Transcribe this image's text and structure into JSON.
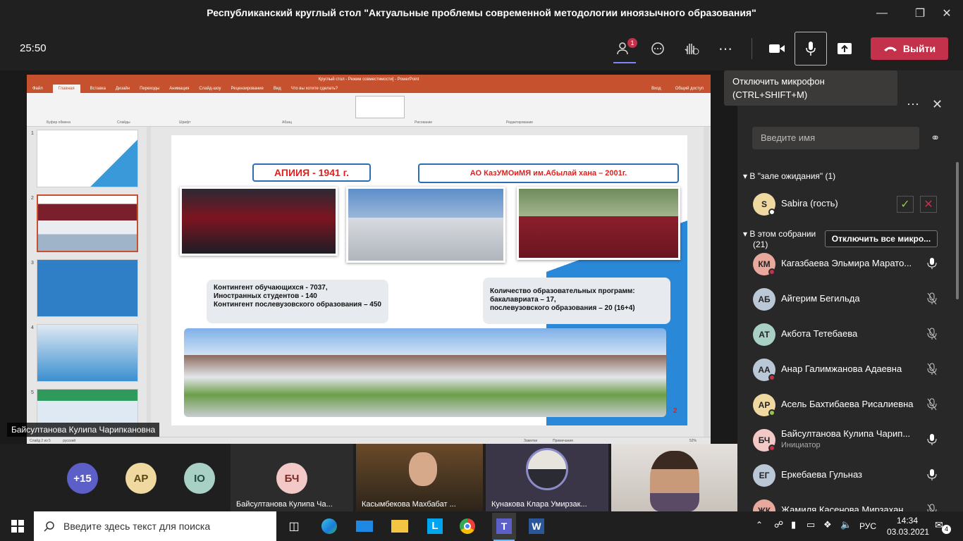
{
  "window": {
    "title": "Республиканский круглый стол \"Актуальные проблемы современной методологии иноязычного образования\""
  },
  "toolbar": {
    "time": "25:50",
    "participants_badge": "1",
    "leave_label": "Выйти"
  },
  "tooltip": {
    "line1": "Отключить микрофон",
    "line2": "(CTRL+SHIFT+M)"
  },
  "ppt": {
    "title": "Круглый стол - Режим совместимости] - PowerPoint",
    "tabs": [
      "Файл",
      "Главная",
      "Вставка",
      "Дизайн",
      "Переходы",
      "Анимация",
      "Слайд-шоу",
      "Рецензирование",
      "Вид",
      "Что вы хотите сделать?"
    ],
    "share": "Общий доступ",
    "login": "Вход",
    "ribbon_groups": [
      "Буфер обмена",
      "Слайды",
      "Шрифт",
      "Абзац",
      "Рисование",
      "Редактирование"
    ],
    "status_left": "Слайд 2 из 5",
    "status_lang": "русский",
    "status_notes": "Заметки",
    "status_comments": "Примечания",
    "status_zoom": "52%",
    "thumb_numbers": [
      "1",
      "2",
      "3",
      "4",
      "5"
    ]
  },
  "slide": {
    "left_title": "АПИИЯ -  1941 г.",
    "right_title": "АО КазУМОиМЯ им.Абылай хана – 2001г.",
    "info_left": [
      "Контингент обучающихся - 7037,",
      "Иностранных студентов -  140",
      "Контингент послевузовского образования – 450"
    ],
    "info_right": [
      "Количество образовательных программ:",
      " бакалавриата – 17,",
      "послевузовского образования – 20 (16+4)"
    ],
    "page_num": "2"
  },
  "presenter_label": "Байсултанова Кулипа Чарипкановна",
  "strip": {
    "more": "+15",
    "avatars": [
      "АР",
      "IO"
    ],
    "tiles": [
      {
        "initials": "БЧ",
        "name": "Байсултанова Кулипа Ча..."
      },
      {
        "name": "Касымбекова Махбабат ..."
      },
      {
        "name": "Кунакова Клара Умирзак..."
      }
    ]
  },
  "panel": {
    "name_placeholder": "Введите имя",
    "lobby_header": "В \"зале ожидания\" (1)",
    "lobby_person": {
      "initials": "S",
      "name": "Sabira (гость)"
    },
    "meeting_header_line1": "В этом собрании",
    "meeting_header_line2": "(21)",
    "mute_all": "Отключить все микро...",
    "people": [
      {
        "initials": "КМ",
        "name": "Кагазбаева Эльмира Марато...",
        "color": "#e8a89c",
        "mic": "on",
        "dot": "#c4314b"
      },
      {
        "initials": "АБ",
        "name": "Айгерим Бегильда",
        "color": "#b9c7d6",
        "mic": "off",
        "dot": ""
      },
      {
        "initials": "АТ",
        "name": "Акбота Тетебаева",
        "color": "#a9d0c4",
        "mic": "off",
        "dot": ""
      },
      {
        "initials": "АА",
        "name": "Анар Галимжанова Адаевна",
        "color": "#b9c7d6",
        "mic": "off",
        "dot": "#c4314b"
      },
      {
        "initials": "АР",
        "name": "Асель Бахтибаева Рисалиевна",
        "color": "#f0d9a0",
        "mic": "off",
        "dot": "#92c353"
      },
      {
        "initials": "БЧ",
        "name": "Байсултанова Кулипа Чарип...",
        "sub": "Инициатор",
        "color": "#f2c9c7",
        "mic": "on",
        "dot": "#c4314b"
      },
      {
        "initials": "ЕГ",
        "name": "Еркебаева Гульназ",
        "color": "#b9c7d6",
        "mic": "on",
        "dot": ""
      },
      {
        "initials": "ЖК",
        "name": "Жамиля Касенова Мирзахан...",
        "color": "#e8a89c",
        "mic": "off",
        "dot": ""
      }
    ]
  },
  "taskbar": {
    "search_placeholder": "Введите здесь текст для поиска",
    "lang": "РУС",
    "clock_time": "14:34",
    "clock_date": "03.03.2021",
    "notif_count": "4"
  }
}
